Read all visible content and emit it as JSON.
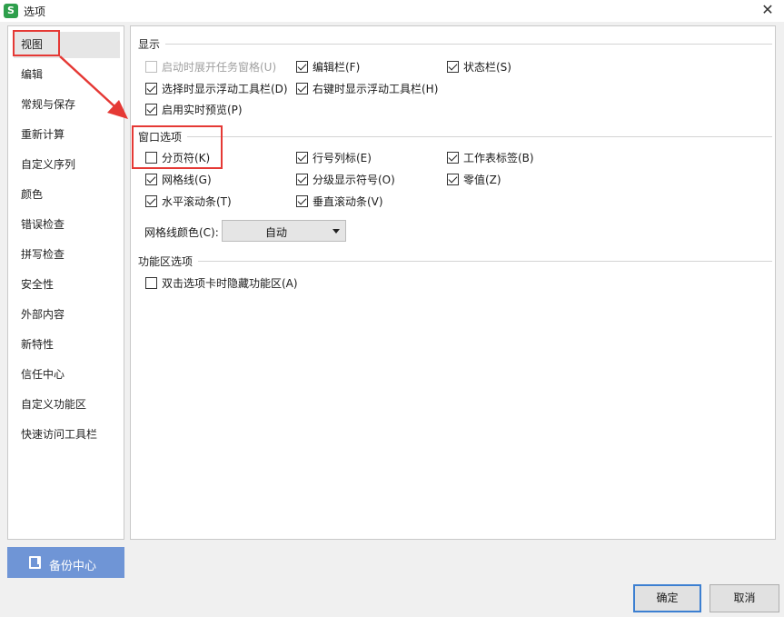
{
  "window": {
    "title": "选项",
    "app_icon_glyph": "S",
    "app_icon_color": "#2e9f4c",
    "close_glyph": "✕"
  },
  "sidebar": {
    "items": [
      {
        "label": "视图",
        "selected": true
      },
      {
        "label": "编辑"
      },
      {
        "label": "常规与保存"
      },
      {
        "label": "重新计算"
      },
      {
        "label": "自定义序列"
      },
      {
        "label": "颜色"
      },
      {
        "label": "错误检查"
      },
      {
        "label": "拼写检查"
      },
      {
        "label": "安全性"
      },
      {
        "label": "外部内容"
      },
      {
        "label": "新特性"
      },
      {
        "label": "信任中心"
      },
      {
        "label": "自定义功能区"
      },
      {
        "label": "快速访问工具栏"
      }
    ],
    "backup_button": {
      "label": "备份中心",
      "icon": "backup-icon",
      "color": "#6f95d6"
    }
  },
  "sections": {
    "display": {
      "title": "显示",
      "options": [
        {
          "label": "启动时展开任务窗格(U)",
          "checked": false,
          "disabled": true
        },
        {
          "label": "编辑栏(F)",
          "checked": true
        },
        {
          "label": "状态栏(S)",
          "checked": true
        },
        {
          "label": "选择时显示浮动工具栏(D)",
          "checked": true
        },
        {
          "label": "右键时显示浮动工具栏(H)",
          "checked": true
        },
        {
          "label": "启用实时预览(P)",
          "checked": true
        }
      ]
    },
    "window_options": {
      "title": "窗口选项",
      "options": [
        {
          "label": "分页符(K)",
          "checked": false
        },
        {
          "label": "行号列标(E)",
          "checked": true
        },
        {
          "label": "工作表标签(B)",
          "checked": true
        },
        {
          "label": "网格线(G)",
          "checked": true
        },
        {
          "label": "分级显示符号(O)",
          "checked": true
        },
        {
          "label": "零值(Z)",
          "checked": true
        },
        {
          "label": "水平滚动条(T)",
          "checked": true
        },
        {
          "label": "垂直滚动条(V)",
          "checked": true
        }
      ],
      "gridline_color": {
        "label": "网格线颜色(C):",
        "value": "自动"
      }
    },
    "ribbon": {
      "title": "功能区选项",
      "options": [
        {
          "label": "双击选项卡时隐藏功能区(A)",
          "checked": false
        }
      ]
    }
  },
  "buttons": {
    "ok": "确定",
    "cancel": "取消"
  },
  "annotations": {
    "highlight_color": "#e53935"
  }
}
